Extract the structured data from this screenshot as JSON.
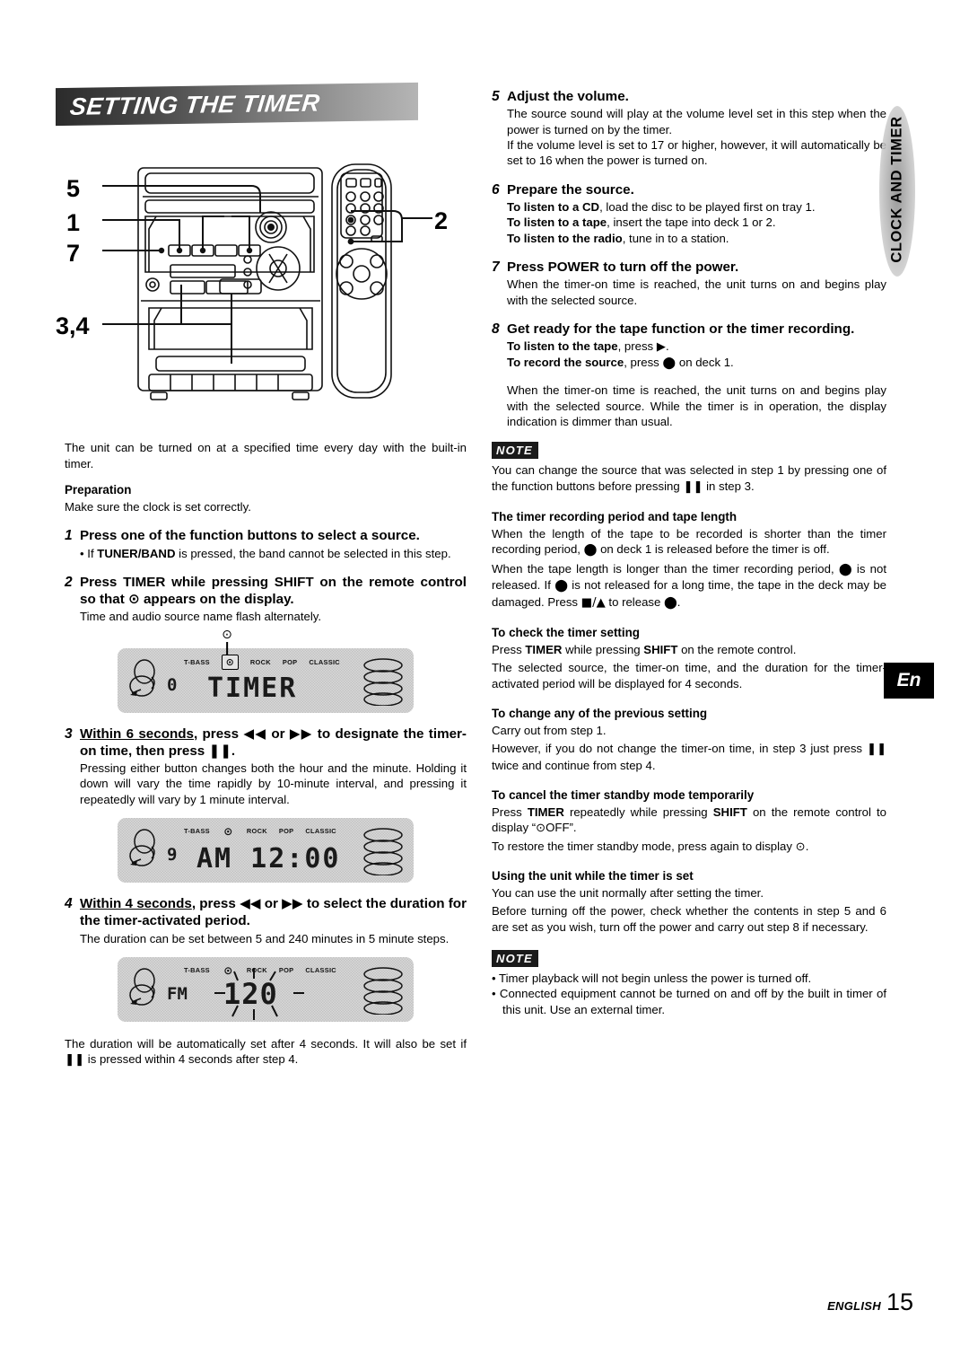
{
  "banner": {
    "title": "SETTING THE TIMER"
  },
  "side_tab": {
    "label": "CLOCK AND TIMER"
  },
  "lang_badge": {
    "label": "En"
  },
  "footer": {
    "label": "ENGLISH",
    "page": "15"
  },
  "illustration": {
    "callouts": [
      "5",
      "1",
      "7",
      "3,4",
      "2"
    ]
  },
  "left": {
    "intro": "The unit can be turned on at a specified time every day with the built-in timer.",
    "preparation_head": "Preparation",
    "preparation_text": "Make sure the clock is set correctly.",
    "step1": {
      "num": "1",
      "title": "Press one of the function buttons to select a source.",
      "bullet": "• If TUNER/BAND is pressed, the band cannot be selected in this step."
    },
    "step2": {
      "num": "2",
      "title": "Press TIMER while pressing SHIFT on the remote control so that ⊙ appears on the display.",
      "detail": "Time and audio source name flash alternately."
    },
    "step3": {
      "num": "3",
      "title": "Within 6 seconds, press ◀◀ or ▶▶ to designate the timer-on time, then press ❚❚.",
      "detail": "Pressing either button changes both the hour and the minute. Holding it down will vary the time rapidly by 10-minute interval, and pressing it repeatedly will vary by 1 minute interval."
    },
    "step4": {
      "num": "4",
      "title": "Within 4 seconds, press ◀◀ or ▶▶ to select the duration for the timer-activated period.",
      "detail": "The duration can be set between 5 and 240 minutes in 5 minute steps."
    },
    "closing": "The duration will be automatically set after 4 seconds. It will also be set if ❚❚ is pressed within 4 seconds after step 4."
  },
  "lcd": {
    "labels": [
      "T-BASS",
      "ROCK",
      "POP",
      "CLASSIC"
    ],
    "clock_symbol": "⊙",
    "display1": {
      "text": "TIMER",
      "prefix": "0"
    },
    "display2": {
      "prefix": "9",
      "text": "AM 12:00"
    },
    "display3": {
      "prefix": "FM",
      "digits": "120"
    }
  },
  "right": {
    "step5": {
      "num": "5",
      "title": "Adjust the volume.",
      "detail1": "The source sound will play at the volume level set in this step when the power is turned on by the timer.",
      "detail2": "If the volume level is set to 17 or higher, however, it will automatically be set to 16 when the power is turned on."
    },
    "step6": {
      "num": "6",
      "title": "Prepare the source.",
      "line1_bold": "To listen to a CD",
      "line1_rest": ", load the disc to be played first on tray 1.",
      "line2_bold": "To listen to a tape",
      "line2_rest": ", insert the tape into deck 1 or 2.",
      "line3_bold": "To listen to the radio",
      "line3_rest": ", tune in to a station."
    },
    "step7": {
      "num": "7",
      "title": "Press POWER to turn off the power.",
      "detail": "When the timer-on time is reached, the unit turns on and begins play with the selected source."
    },
    "step8": {
      "num": "8",
      "title": "Get ready for the tape function or the timer recording.",
      "line1_bold": "To listen to the tape",
      "line1_rest": ", press ▶.",
      "line2_bold": "To record the source",
      "line2_rest": ", press ⬤ on deck 1."
    },
    "after_step8": "When the timer-on time is reached, the unit turns on and begins play with the selected source. While the timer is in operation, the display indication is dimmer than usual.",
    "note1_badge": "NOTE",
    "note1_text": "You can change the source that was selected in step 1 by pressing one of the function buttons before pressing ❚❚ in step 3.",
    "section_recording": {
      "head": "The timer recording period and tape length",
      "p1": "When the length of the tape to be recorded is shorter than the timer recording period, ⬤ on deck 1 is released before the timer is off.",
      "p2": "When the tape length is longer than the timer recording period, ⬤ is not released. If ⬤ is not released for a long time, the tape in the deck may be damaged. Press ■/▲ to release ⬤."
    },
    "section_check": {
      "head": "To check the timer setting",
      "p1_a": "Press ",
      "p1_b": "TIMER",
      "p1_c": " while pressing ",
      "p1_d": "SHIFT",
      "p1_e": " on the remote control.",
      "p2": "The selected source, the timer-on time, and the duration for the timer-activated period will be displayed for 4 seconds."
    },
    "section_change": {
      "head": "To change any of the previous setting",
      "p1": "Carry out from step 1.",
      "p2": "However, if you do not change the timer-on time, in step 3 just press ❚❚ twice and continue from step 4."
    },
    "section_cancel": {
      "head": "To cancel the timer standby mode temporarily",
      "p1_a": "Press ",
      "p1_b": "TIMER",
      "p1_c": " repeatedly while pressing ",
      "p1_d": "SHIFT",
      "p1_e": " on the remote control to display “⊙OFF”.",
      "p2": "To restore the timer standby mode, press again to display ⊙."
    },
    "section_using": {
      "head": "Using the unit while the timer is set",
      "p1": "You can use the unit normally after setting the timer.",
      "p2": "Before turning off the power, check whether the contents in step 5 and 6 are set as you wish, turn off the power and carry out step 8 if necessary."
    },
    "note2_badge": "NOTE",
    "note2_b1": "• Timer playback will not begin unless the power is turned off.",
    "note2_b2": "• Connected equipment cannot be turned on and off by the built in timer of this unit.  Use an external timer."
  }
}
